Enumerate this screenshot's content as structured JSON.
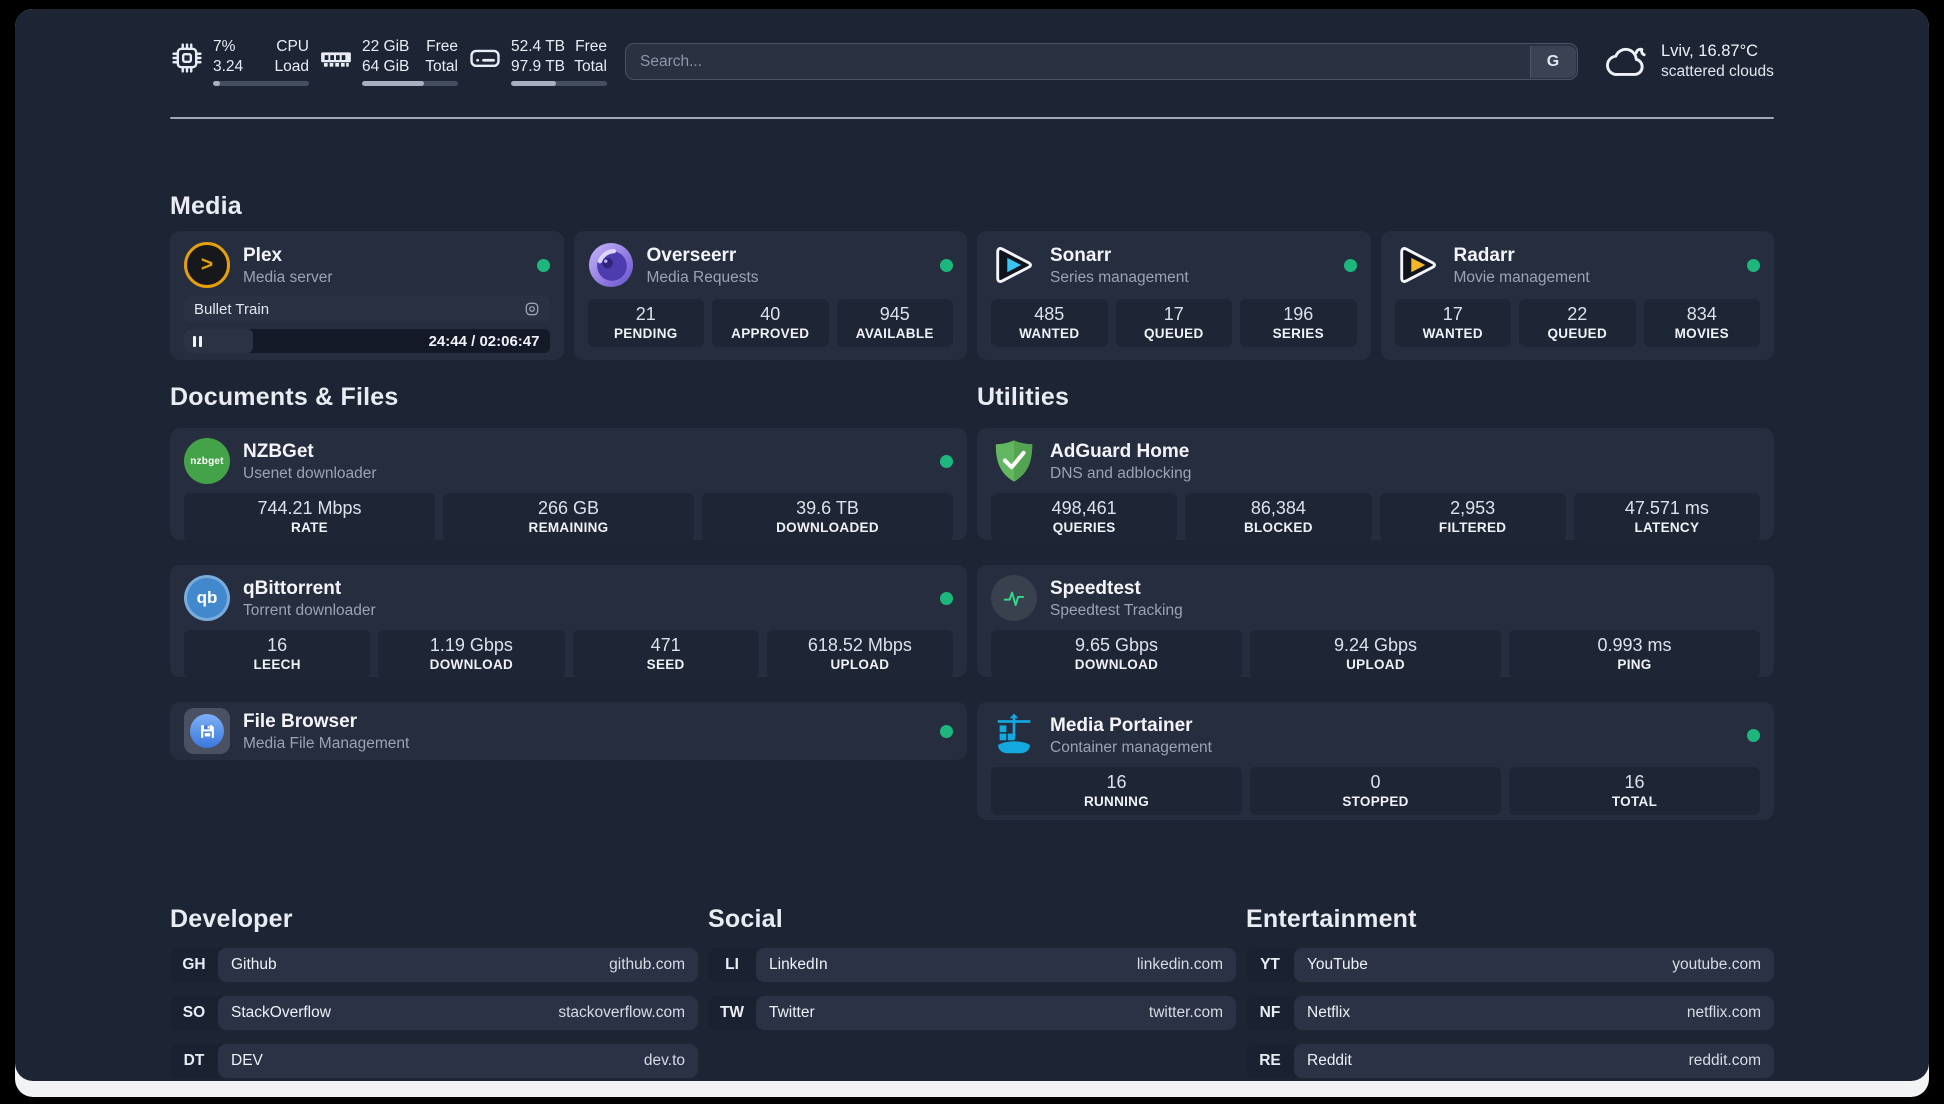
{
  "colors": {
    "status_online": "#1db77e",
    "plex_accent": "#e5a00d",
    "sonarr_accent": "#38c5f2",
    "radarr_accent": "#f7b528",
    "portainer_accent": "#13a8e0",
    "speedtest_pulse": "#30d98a"
  },
  "header": {
    "metrics": [
      {
        "id": "cpu",
        "icon": "cpu-icon",
        "values": [
          "7%",
          "3.24"
        ],
        "labels": [
          "CPU",
          "Load"
        ],
        "progress": 7
      },
      {
        "id": "memory",
        "icon": "ram-icon",
        "values": [
          "22 GiB",
          "64 GiB"
        ],
        "labels": [
          "Free",
          "Total"
        ],
        "progress": 65
      },
      {
        "id": "storage",
        "icon": "disk-icon",
        "values": [
          "52.4 TB",
          "97.9 TB"
        ],
        "labels": [
          "Free",
          "Total"
        ],
        "progress": 47
      }
    ],
    "search": {
      "placeholder": "Search...",
      "button_label": "G"
    },
    "weather": {
      "icon": "cloud-icon",
      "location": "Lviv, 16.87°C",
      "condition": "scattered clouds"
    }
  },
  "sections": {
    "media": {
      "title": "Media",
      "cards": [
        {
          "id": "plex",
          "icon": "plex-icon",
          "title": "Plex",
          "subtitle": "Media server",
          "online": true,
          "player": {
            "title": "Bullet Train",
            "progress": 19,
            "time": "24:44 / 02:06:47"
          }
        },
        {
          "id": "overseerr",
          "icon": "overseerr-icon",
          "title": "Overseerr",
          "subtitle": "Media Requests",
          "online": true,
          "stats": [
            {
              "value": "21",
              "label": "PENDING"
            },
            {
              "value": "40",
              "label": "APPROVED"
            },
            {
              "value": "945",
              "label": "AVAILABLE"
            }
          ]
        },
        {
          "id": "sonarr",
          "icon": "sonarr-icon",
          "title": "Sonarr",
          "subtitle": "Series management",
          "online": true,
          "stats": [
            {
              "value": "485",
              "label": "WANTED"
            },
            {
              "value": "17",
              "label": "QUEUED"
            },
            {
              "value": "196",
              "label": "SERIES"
            }
          ]
        },
        {
          "id": "radarr",
          "icon": "radarr-icon",
          "title": "Radarr",
          "subtitle": "Movie management",
          "online": true,
          "stats": [
            {
              "value": "17",
              "label": "WANTED"
            },
            {
              "value": "22",
              "label": "QUEUED"
            },
            {
              "value": "834",
              "label": "MOVIES"
            }
          ]
        }
      ]
    },
    "documents": {
      "title": "Documents & Files",
      "cards": [
        {
          "id": "nzbget",
          "icon": "nzbget-icon",
          "title": "NZBGet",
          "subtitle": "Usenet downloader",
          "online": true,
          "stats": [
            {
              "value": "744.21 Mbps",
              "label": "RATE"
            },
            {
              "value": "266 GB",
              "label": "REMAINING"
            },
            {
              "value": "39.6 TB",
              "label": "DOWNLOADED"
            }
          ]
        },
        {
          "id": "qbittorrent",
          "icon": "qbittorrent-icon",
          "title": "qBittorrent",
          "subtitle": "Torrent downloader",
          "online": true,
          "stats": [
            {
              "value": "16",
              "label": "LEECH"
            },
            {
              "value": "1.19 Gbps",
              "label": "DOWNLOAD"
            },
            {
              "value": "471",
              "label": "SEED"
            },
            {
              "value": "618.52 Mbps",
              "label": "UPLOAD"
            }
          ]
        },
        {
          "id": "filebrowser",
          "icon": "filebrowser-icon",
          "title": "File Browser",
          "subtitle": "Media File Management",
          "online": true,
          "compact": true
        }
      ]
    },
    "utilities": {
      "title": "Utilities",
      "cards": [
        {
          "id": "adguard",
          "icon": "adguard-icon",
          "title": "AdGuard Home",
          "subtitle": "DNS and adblocking",
          "online": false,
          "stats": [
            {
              "value": "498,461",
              "label": "QUERIES"
            },
            {
              "value": "86,384",
              "label": "BLOCKED"
            },
            {
              "value": "2,953",
              "label": "FILTERED"
            },
            {
              "value": "47.571 ms",
              "label": "LATENCY"
            }
          ]
        },
        {
          "id": "speedtest",
          "icon": "speedtest-icon",
          "title": "Speedtest",
          "subtitle": "Speedtest Tracking",
          "online": false,
          "stats": [
            {
              "value": "9.65 Gbps",
              "label": "DOWNLOAD"
            },
            {
              "value": "9.24 Gbps",
              "label": "UPLOAD"
            },
            {
              "value": "0.993 ms",
              "label": "PING"
            }
          ]
        },
        {
          "id": "portainer",
          "icon": "portainer-icon",
          "title": "Media Portainer",
          "subtitle": "Container management",
          "online": true,
          "tall": true,
          "stats": [
            {
              "value": "16",
              "label": "RUNNING"
            },
            {
              "value": "0",
              "label": "STOPPED"
            },
            {
              "value": "16",
              "label": "TOTAL"
            }
          ]
        }
      ]
    },
    "link_groups": [
      {
        "title": "Developer",
        "links": [
          {
            "badge": "GH",
            "name": "Github",
            "url": "github.com"
          },
          {
            "badge": "SO",
            "name": "StackOverflow",
            "url": "stackoverflow.com"
          },
          {
            "badge": "DT",
            "name": "DEV",
            "url": "dev.to"
          }
        ]
      },
      {
        "title": "Social",
        "links": [
          {
            "badge": "LI",
            "name": "LinkedIn",
            "url": "linkedin.com"
          },
          {
            "badge": "TW",
            "name": "Twitter",
            "url": "twitter.com"
          }
        ]
      },
      {
        "title": "Entertainment",
        "links": [
          {
            "badge": "YT",
            "name": "YouTube",
            "url": "youtube.com"
          },
          {
            "badge": "NF",
            "name": "Netflix",
            "url": "netflix.com"
          },
          {
            "badge": "RE",
            "name": "Reddit",
            "url": "reddit.com"
          }
        ]
      }
    ]
  }
}
